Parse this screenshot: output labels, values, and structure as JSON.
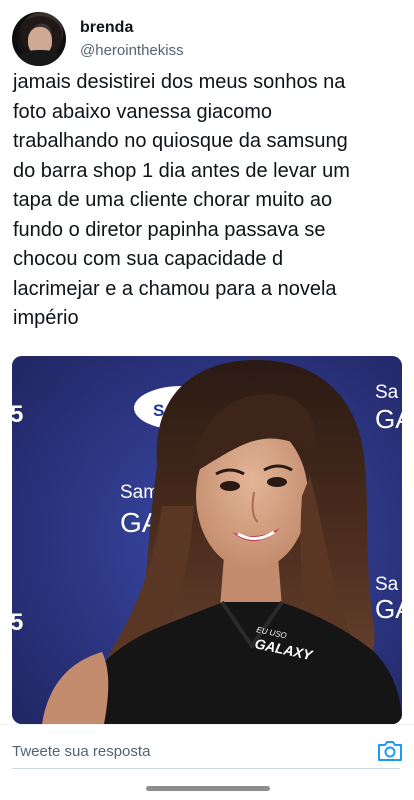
{
  "tweet": {
    "author": {
      "display_name": "brenda",
      "handle": "@herointhekiss"
    },
    "text_lines": [
      "jamais desistirei dos meus sonhos na",
      "foto abaixo vanessa giacomo",
      "trabalhando no quiosque da samsung",
      "do barra shop 1 dia antes de levar um",
      "tapa de uma cliente chorar muito ao",
      "fundo o diretor papinha passava se",
      "chocou com sua capacidade d",
      "lacrimejar e a chamou para a novela",
      "império"
    ],
    "media": {
      "backdrop_texts": {
        "left_top": "5",
        "left_bottom": "5",
        "samsung_logo": "SAM",
        "samsung_word_1": "Sams",
        "galaxy_word_1": "GAL",
        "samsung_word_2": "Sa",
        "galaxy_word_2": "GA",
        "samsung_word_3": "Sa",
        "galaxy_word_3": "GA"
      },
      "shirt_logo": {
        "line1": "EU USO",
        "line2": "GALAXY"
      }
    }
  },
  "reply": {
    "placeholder": "Tweete sua resposta"
  },
  "colors": {
    "accent": "#1d9bf0",
    "text_primary": "#0f1419",
    "text_secondary": "#536471",
    "backdrop_blue": "#2d3788"
  },
  "icons": {
    "reply_camera": "camera-icon"
  }
}
